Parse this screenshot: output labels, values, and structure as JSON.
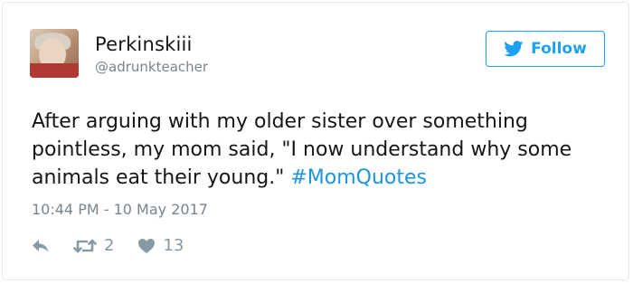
{
  "user": {
    "display_name": "Perkinskiii",
    "handle": "@adrunkteacher"
  },
  "follow_button": {
    "label": "Follow",
    "icon": "twitter-bird-icon"
  },
  "tweet": {
    "text": "After arguing with my older sister over something pointless, my mom said, \"I now understand why some animals eat their young.\" ",
    "hashtag": "#MomQuotes",
    "timestamp": "10:44 PM - 10 May 2017"
  },
  "actions": {
    "reply_icon": "reply-icon",
    "retweet_icon": "retweet-icon",
    "retweet_count": "2",
    "like_icon": "heart-icon",
    "like_count": "13"
  },
  "colors": {
    "accent": "#1da1f2",
    "hashtag": "#1b95e0",
    "text": "#14171a",
    "muted": "#7a848c",
    "action_grey": "#8899a6",
    "border": "#e1e8ed"
  }
}
